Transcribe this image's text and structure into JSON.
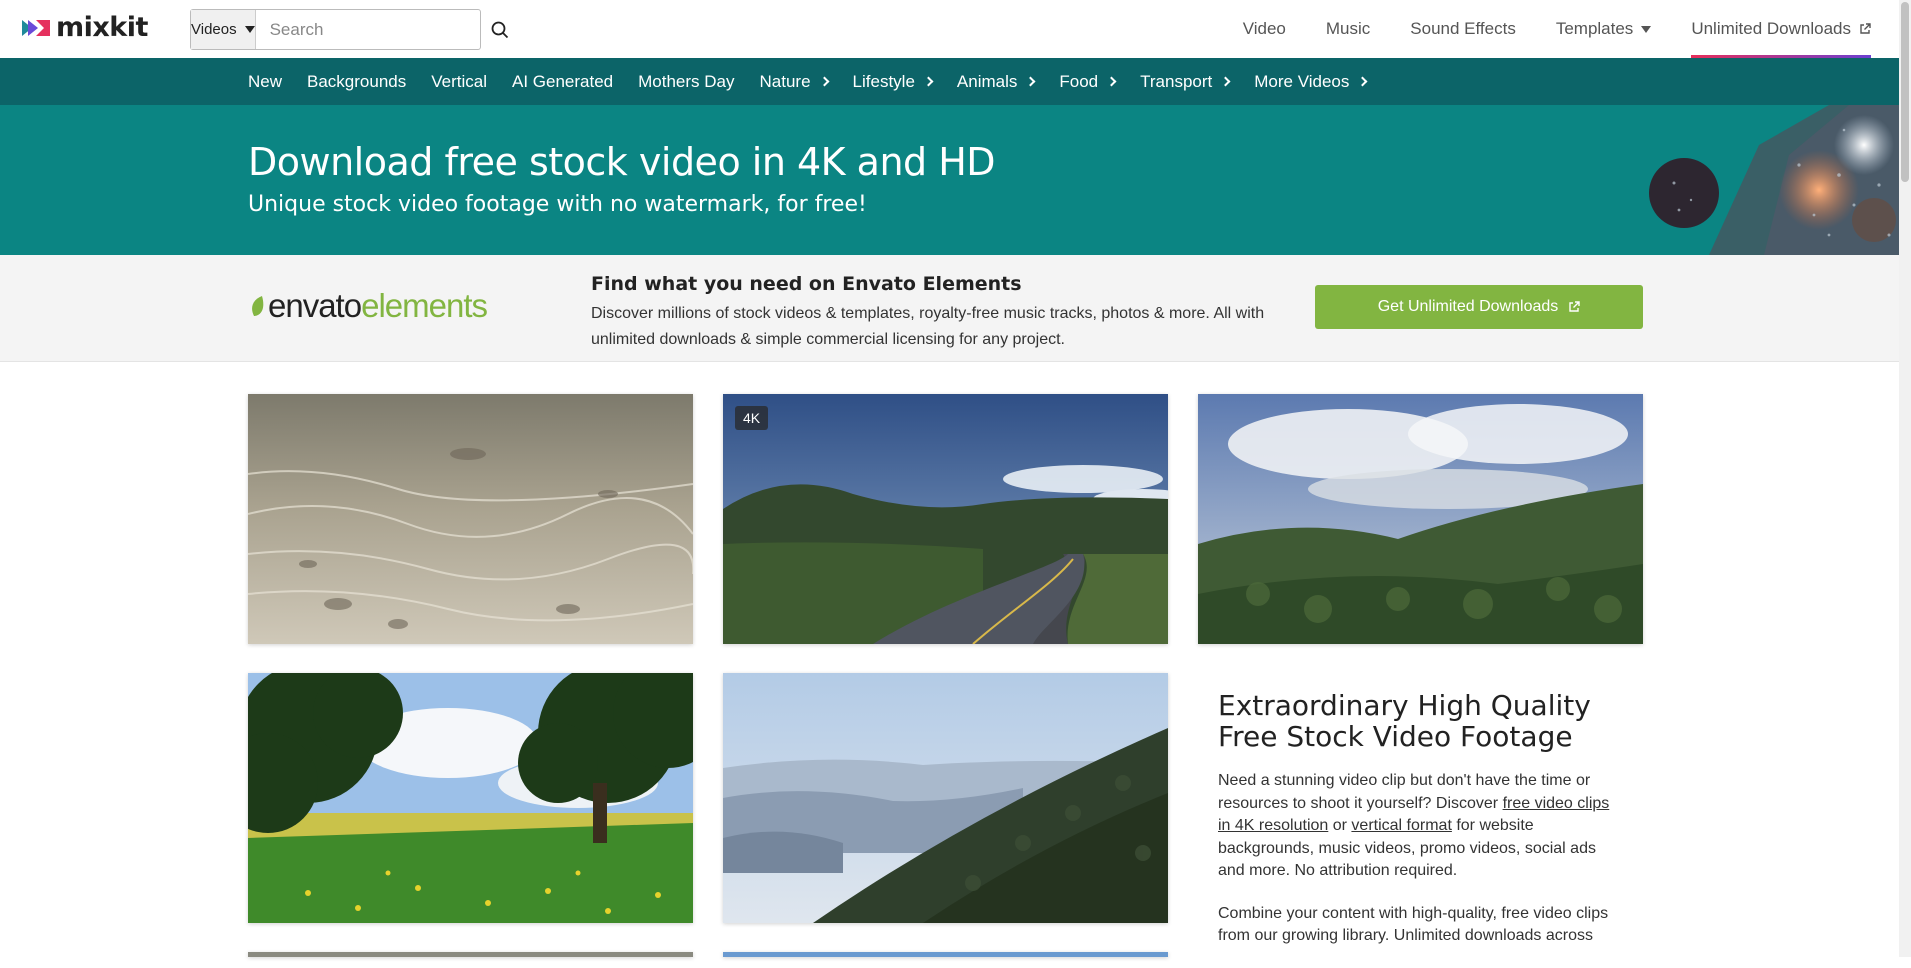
{
  "header": {
    "logo_text": "mixkit",
    "search": {
      "category": "Videos",
      "placeholder": "Search"
    },
    "nav": [
      {
        "label": "Video"
      },
      {
        "label": "Music"
      },
      {
        "label": "Sound Effects"
      },
      {
        "label": "Templates"
      },
      {
        "label": "Unlimited Downloads"
      }
    ]
  },
  "categories": [
    {
      "label": "New",
      "has_chevron": false
    },
    {
      "label": "Backgrounds",
      "has_chevron": false
    },
    {
      "label": "Vertical",
      "has_chevron": false
    },
    {
      "label": "AI Generated",
      "has_chevron": false
    },
    {
      "label": "Mothers Day",
      "has_chevron": false
    },
    {
      "label": "Nature",
      "has_chevron": true
    },
    {
      "label": "Lifestyle",
      "has_chevron": true
    },
    {
      "label": "Animals",
      "has_chevron": true
    },
    {
      "label": "Food",
      "has_chevron": true
    },
    {
      "label": "Transport",
      "has_chevron": true
    },
    {
      "label": "More Videos",
      "has_chevron": true
    }
  ],
  "hero": {
    "title": "Download free stock video in 4K and HD",
    "subtitle": "Unique stock video footage with no watermark, for free!"
  },
  "envato": {
    "logo_part1": "envato",
    "logo_part2": "elements",
    "heading": "Find what you need on Envato Elements",
    "body": "Discover millions of stock videos & templates, royalty-free music tracks, photos & more. All with unlimited downloads & simple commercial licensing for any project.",
    "button_label": "Get Unlimited Downloads"
  },
  "videos": [
    {
      "scene": "shallow-water-stream",
      "badge": ""
    },
    {
      "scene": "mountain-road",
      "badge": "4K"
    },
    {
      "scene": "green-valley-hills",
      "badge": ""
    },
    {
      "scene": "tree-meadow-flowers",
      "badge": ""
    },
    {
      "scene": "forest-mountain-haze",
      "badge": ""
    }
  ],
  "info": {
    "title": "Extraordinary High Quality Free Stock Video Footage",
    "p1_before": "Need a stunning video clip but don't have the time or resources to shoot it yourself? Discover ",
    "p1_link1": "free video clips in 4K resolution",
    "p1_mid": " or ",
    "p1_link2": "vertical format",
    "p1_after": " for website backgrounds, music videos, promo videos, social ads and more. No attribution required.",
    "p2": "Combine your content with high-quality, free video clips from our growing library. Unlimited downloads across"
  },
  "colors": {
    "catbar": "#0c6468",
    "hero": "#0b8583",
    "envato_green": "#82b541"
  }
}
